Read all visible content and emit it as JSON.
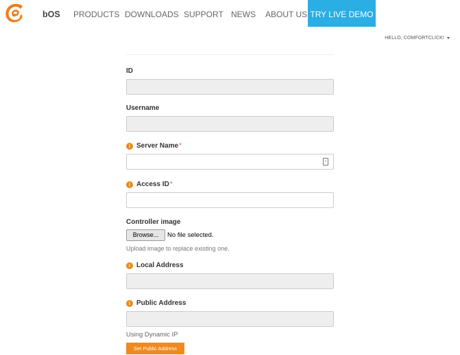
{
  "nav": {
    "brand": "bOS",
    "items": [
      "PRODUCTS",
      "DOWNLOADS",
      "SUPPORT",
      "NEWS",
      "ABOUT US"
    ],
    "demo_label": "TRY LIVE DEMO",
    "user_greeting": "HELLO, COMFORTCLICK!",
    "accent_color": "#2aaee3"
  },
  "form": {
    "id_label": "ID",
    "username_label": "Username",
    "server_name_label": "Server Name",
    "access_id_label": "Access ID",
    "required_mark": "*",
    "info_icon_glyph": "i",
    "controller_image_label": "Controller image",
    "browse_label": "Browse...",
    "file_status": "No file selected.",
    "upload_help": "Upload image to replace existing one.",
    "local_address_label": "Local Address",
    "public_address_label": "Public Address",
    "dynamic_ip_text": "Using Dynamic IP",
    "set_public_address_label": "Set Public Address",
    "button_color": "#f0891e"
  }
}
